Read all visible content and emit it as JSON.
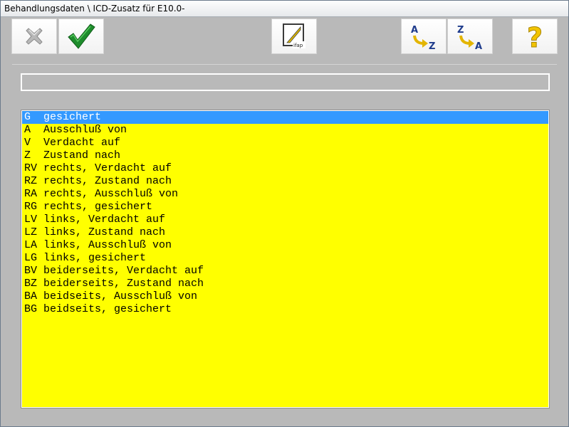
{
  "window": {
    "title": "Behandlungsdaten \\ ICD-Zusatz für E10.0-"
  },
  "toolbar": {
    "buttons": [
      {
        "name": "cancel-button",
        "icon": "close-x-icon"
      },
      {
        "name": "ok-button",
        "icon": "checkmark-icon"
      },
      {
        "name": "ifap-button",
        "icon": "ifap-logo-icon",
        "logo_text": "ifap"
      },
      {
        "name": "sort-ascending-button",
        "icon": "sort-a-z-icon",
        "glyphs": [
          "A",
          "Z"
        ]
      },
      {
        "name": "sort-descending-button",
        "icon": "sort-z-a-icon",
        "glyphs": [
          "Z",
          "A"
        ]
      },
      {
        "name": "help-button",
        "icon": "question-mark-icon",
        "glyph": "?"
      }
    ]
  },
  "filter_input": {
    "value": ""
  },
  "list": {
    "selected_index": 0,
    "colors": {
      "background": "#ffff00",
      "selection": "#3399ff"
    },
    "items": [
      {
        "code": "G",
        "text": "gesichert"
      },
      {
        "code": "A",
        "text": "Ausschluß von"
      },
      {
        "code": "V",
        "text": "Verdacht auf"
      },
      {
        "code": "Z",
        "text": "Zustand nach"
      },
      {
        "code": "RV",
        "text": "rechts, Verdacht auf"
      },
      {
        "code": "RZ",
        "text": "rechts, Zustand nach"
      },
      {
        "code": "RA",
        "text": "rechts, Ausschluß von"
      },
      {
        "code": "RG",
        "text": "rechts, gesichert"
      },
      {
        "code": "LV",
        "text": "links, Verdacht auf"
      },
      {
        "code": "LZ",
        "text": "links, Zustand nach"
      },
      {
        "code": "LA",
        "text": "links, Ausschluß von"
      },
      {
        "code": "LG",
        "text": "links, gesichert"
      },
      {
        "code": "BV",
        "text": "beiderseits, Verdacht auf"
      },
      {
        "code": "BZ",
        "text": "beiderseits, Zustand nach"
      },
      {
        "code": "BA",
        "text": "beidseits, Ausschluß von"
      },
      {
        "code": "BG",
        "text": "beidseits, gesichert"
      }
    ]
  }
}
